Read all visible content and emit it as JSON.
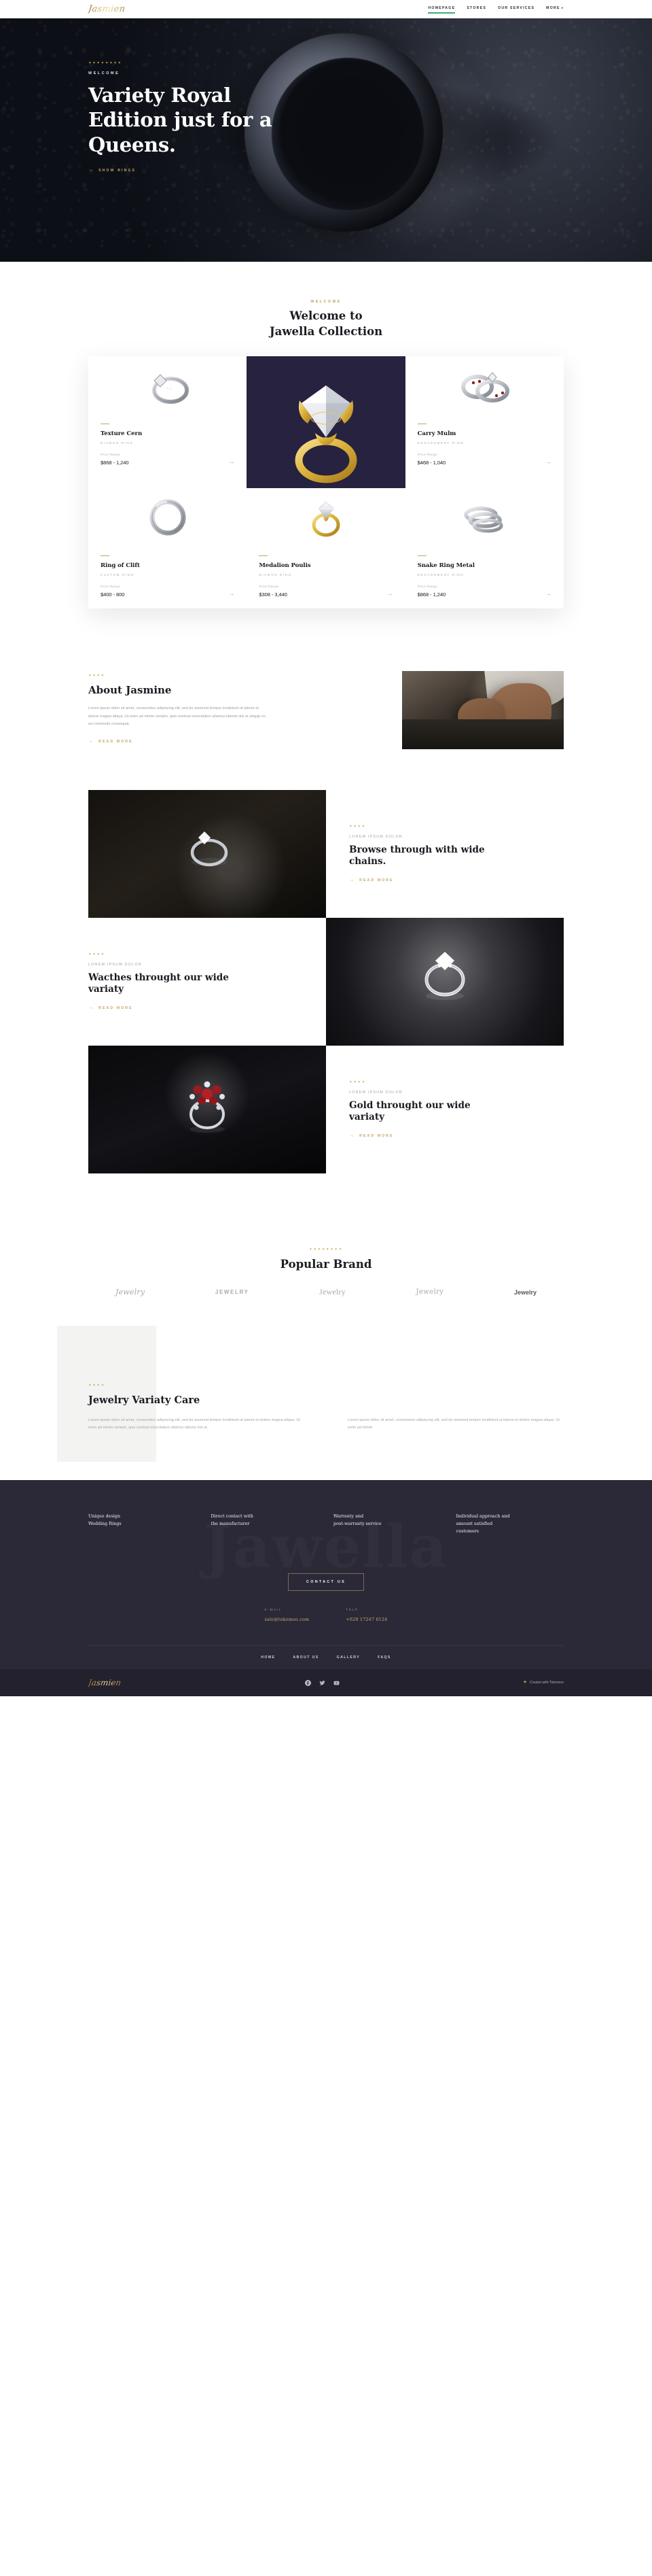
{
  "brand": {
    "name": "Jasmien"
  },
  "nav": {
    "items": [
      {
        "label": "HOMEPAGE",
        "active": true
      },
      {
        "label": "STORES",
        "active": false
      },
      {
        "label": "OUR SERVICES",
        "active": false
      },
      {
        "label": "MORE",
        "active": false,
        "caret": "▾"
      }
    ]
  },
  "hero": {
    "dots": "✦✦✦✦✦✦✦✦",
    "eyebrow": "WELCOME",
    "title": "Variety Royal Edition just for a Queens.",
    "cta": "SHOW RINGS",
    "arrow": "→"
  },
  "welcome": {
    "kicker": "WELCOME",
    "title_line1": "Welcome to",
    "title_line2": "Jawella Collection",
    "products": [
      {
        "name": "Texture Cern",
        "category": "DIAMON RING",
        "price_label": "Price Range",
        "price": "$868 - 1,240",
        "arrow": "→",
        "feature": false,
        "image": "silver-solitaire-ring"
      },
      {
        "name": "",
        "category": "",
        "price_label": "",
        "price": "",
        "arrow": "",
        "feature": true,
        "image": "gold-diamond-ring"
      },
      {
        "name": "Carry Mulm",
        "category": "ENGAGEMENT RING",
        "price_label": "Price Range",
        "price": "$468 - 1,040",
        "arrow": "→",
        "feature": false,
        "image": "ruby-band-set"
      },
      {
        "name": "Ring of Clift",
        "category": "CUSTOM RING",
        "price_label": "Price Range",
        "price": "$400 - 800",
        "arrow": "→",
        "feature": false,
        "image": "plain-band-ring"
      },
      {
        "name": "Medalion Poulis",
        "category": "DIAMON RING",
        "price_label": "Price Range",
        "price": "$308 - 3,440",
        "arrow": "→",
        "feature": false,
        "image": "gold-solitaire-ring"
      },
      {
        "name": "Snake Ring Metal",
        "category": "ENGAGEMENT RING",
        "price_label": "Price Range",
        "price": "$868 - 1,240",
        "arrow": "→",
        "feature": false,
        "image": "stacked-silver-bands"
      }
    ]
  },
  "about": {
    "dots": "✦✦✦✦",
    "title": "About Jasmine",
    "body": "Lorem ipsum dolor sit amet, consectetur adipiscing elit, sed do eiusmod tempor incididunt ut labore et dolore magna aliqua. Ut enim ad minim veniam, quis nostrud exercitation ullamco laboris nisi ut aliquip ex ea commodo consequat.",
    "cta": "READ MORE",
    "arrow": "→",
    "image": "jeweler-at-workbench"
  },
  "features": [
    {
      "dots": "✦✦✦✦",
      "eyebrow": "LOREM IPSUM DOLOR",
      "title": "Browse through with wide chains.",
      "cta": "READ MORE",
      "arrow": "→",
      "image": "diamond-ring-dark-fabric",
      "image_side": "left"
    },
    {
      "dots": "✦✦✦✦",
      "eyebrow": "LOREM IPSUM DOLOR",
      "title": "Wacthes throught our wide variaty",
      "cta": "READ MORE",
      "arrow": "→",
      "image": "silver-ring-grey-studio",
      "image_side": "right"
    },
    {
      "dots": "✦✦✦✦",
      "eyebrow": "LOREM IPSUM DOLOR",
      "title": "Gold throught our wide variaty",
      "cta": "READ MORE",
      "arrow": "→",
      "image": "ruby-flower-ring-black",
      "image_side": "left"
    }
  ],
  "brands": {
    "dots": "✦✦✦✦✦✦✦✦",
    "title": "Popular Brand",
    "logos": [
      "Jewelry",
      "JEWELRY",
      "Jewelry",
      "Jewelry",
      "Jewelry"
    ]
  },
  "care": {
    "dots": "✦✦✦✦",
    "title": "Jewelry Variaty Care",
    "col1": "Lorem ipsum dolor sit amet, consectetur adipiscing elit, sed do eiusmod tempor incididunt ut labore et dolore magna aliqua. Ut enim ad minim veniam, quis nostrud exercitation ullamco laboris nisi ut.",
    "col2": "Lorem ipsum dolor sit amet, consectetur adipiscing elit, sed do eiusmod tempor incididunt ut labore et dolore magna aliqua. Ut enim ad minim"
  },
  "footer": {
    "watermark": "Jawella",
    "columns": [
      "Unique design\nWedding Rings",
      "Direct contact with\nthe manufacturer",
      "Warranty and\npost-warranty service",
      "Individual approach and\namount satisfied\ncustomers"
    ],
    "contact_button": "CONTACT US",
    "email_label": "E-MAIL",
    "email_value": "sale@tokomoo.com",
    "phone_label": "TELP",
    "phone_value": "+628 17247 6124",
    "nav": [
      "HOME",
      "ABOUT US",
      "GALLERY",
      "FAQS"
    ],
    "brand": "Jasmien",
    "socials": [
      "facebook-icon",
      "twitter-icon",
      "youtube-icon"
    ],
    "credit": "Createt with Tokomoo",
    "heart": "♥"
  },
  "colors": {
    "gold": "#c2a55f",
    "accent_green": "#3fae6c",
    "footer_bg": "#2b2838",
    "footer_bottom_bg": "#23212e",
    "feature_card_bg": "#26223f"
  }
}
